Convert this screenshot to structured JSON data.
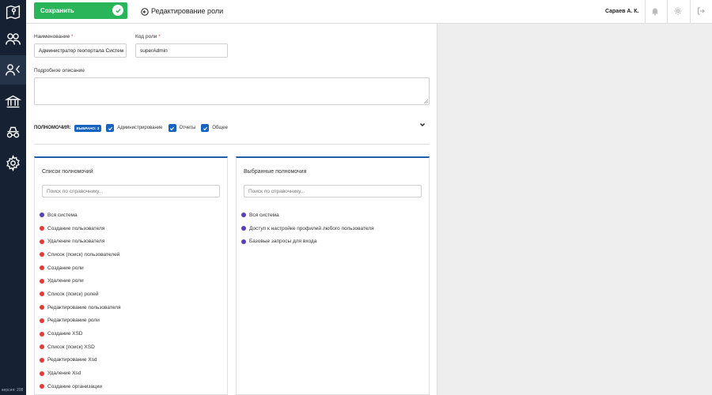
{
  "sidebar": {
    "items": [
      {
        "icon": "map-logo-icon"
      },
      {
        "icon": "users-icon"
      },
      {
        "icon": "user-roles-icon"
      },
      {
        "icon": "institution-icon"
      },
      {
        "icon": "spy-icon"
      },
      {
        "icon": "gear-icon"
      }
    ],
    "version": "версия: 208"
  },
  "header": {
    "save_label": "Сохранить",
    "title": "Редактирование роли",
    "user": "Сараев А. К."
  },
  "form": {
    "name_label": "Наименование",
    "name_value": "Администратор геопортала Систем",
    "code_label": "Код роли",
    "code_value": "superAdmin",
    "required_mark": "*",
    "description_label": "Подробное описание",
    "description_value": ""
  },
  "permissions": {
    "title": "ПОЛНОМОЧИЯ:",
    "badge": "ВЫБРАНО: 3",
    "checks": [
      "Администрирование",
      "Отчеты",
      "Общее"
    ]
  },
  "all_list": {
    "title": "Список полномочий",
    "search_placeholder": "Поиск по справочнику...",
    "items": [
      {
        "label": "Вся система",
        "color": "#5b3fb4"
      },
      {
        "label": "Создание пользователя",
        "color": "#e53935"
      },
      {
        "label": "Удаление пользователя",
        "color": "#e53935"
      },
      {
        "label": "Список (поиск) пользователей",
        "color": "#e53935"
      },
      {
        "label": "Создание роли",
        "color": "#e53935"
      },
      {
        "label": "Удаление роли",
        "color": "#e53935"
      },
      {
        "label": "Список (поиск) ролей",
        "color": "#e53935"
      },
      {
        "label": "Редактирование пользователя",
        "color": "#e53935"
      },
      {
        "label": "Редактирование роли",
        "color": "#e53935"
      },
      {
        "label": "Создание XSD",
        "color": "#e53935"
      },
      {
        "label": "Список (поиск) XSD",
        "color": "#e53935"
      },
      {
        "label": "Редактирование Xsd",
        "color": "#e53935"
      },
      {
        "label": "Удаление Xsd",
        "color": "#e53935"
      },
      {
        "label": "Создание организации",
        "color": "#e53935"
      }
    ]
  },
  "selected_list": {
    "title": "Выбранные полномочия",
    "search_placeholder": "Поиск по справочнику...",
    "items": [
      {
        "label": "Вся система",
        "color": "#5b3fb4"
      },
      {
        "label": "Доступ к настройке профилей любого пользователя",
        "color": "#5b3fb4"
      },
      {
        "label": "Базовые запросы для входа",
        "color": "#5b3fb4"
      }
    ]
  },
  "colors": {
    "sidebar": "#162233",
    "save_button": "#2bb55a",
    "accent_blue": "#1664c0",
    "red_dot": "#e53935",
    "purple_dot": "#5b3fb4"
  }
}
